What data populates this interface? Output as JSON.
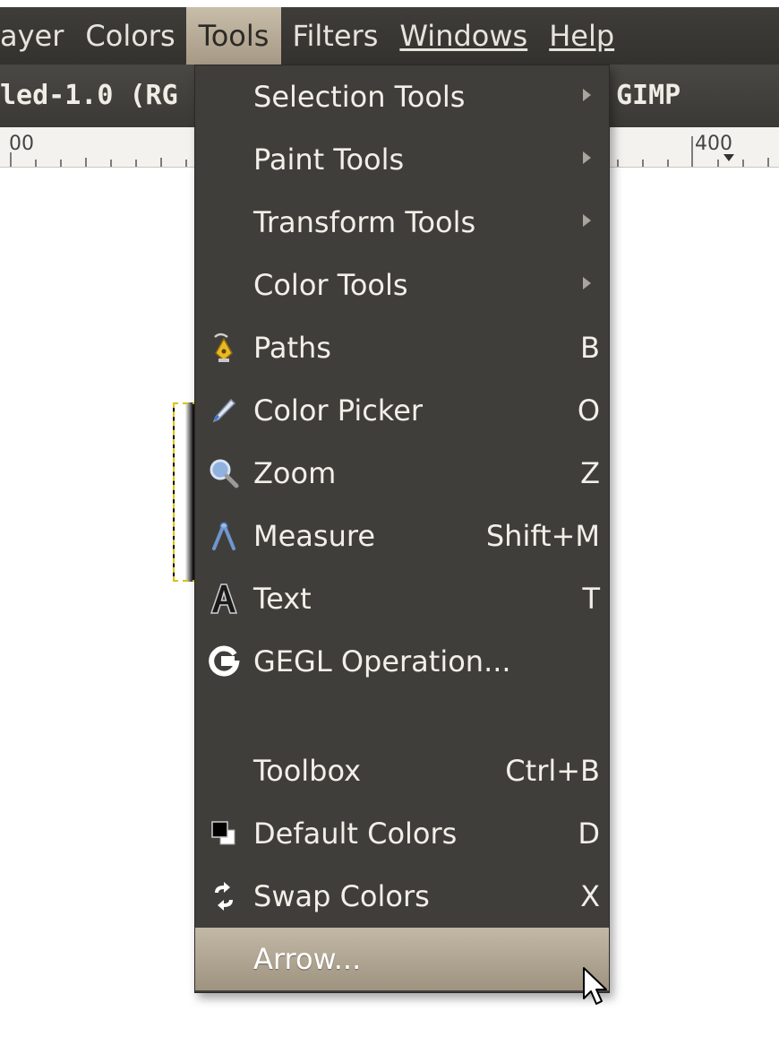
{
  "menubar": {
    "items": [
      {
        "label": "ayer"
      },
      {
        "label": "Colors"
      },
      {
        "label": "Tools"
      },
      {
        "label": "Filters"
      },
      {
        "label": "Windows"
      },
      {
        "label": "Help"
      }
    ]
  },
  "window": {
    "title_left": "led-1.0 (RG",
    "title_right": "GIMP"
  },
  "ruler": {
    "labels": [
      "00",
      "400"
    ]
  },
  "tools_menu": {
    "items": [
      {
        "label": "Selection Tools",
        "submenu": true
      },
      {
        "label": "Paint Tools",
        "submenu": true
      },
      {
        "label": "Transform Tools",
        "submenu": true
      },
      {
        "label": "Color Tools",
        "submenu": true
      },
      {
        "label": "Paths",
        "shortcut": "B",
        "icon": "paths-icon"
      },
      {
        "label": "Color Picker",
        "shortcut": "O",
        "icon": "color-picker-icon"
      },
      {
        "label": "Zoom",
        "shortcut": "Z",
        "icon": "zoom-icon"
      },
      {
        "label": "Measure",
        "shortcut": "Shift+M",
        "icon": "measure-icon"
      },
      {
        "label": "Text",
        "shortcut": "T",
        "icon": "text-icon"
      },
      {
        "label": "GEGL Operation...",
        "icon": "gegl-icon"
      },
      {
        "label": "Toolbox",
        "shortcut": "Ctrl+B"
      },
      {
        "label": "Default Colors",
        "shortcut": "D",
        "icon": "default-colors-icon"
      },
      {
        "label": "Swap Colors",
        "shortcut": "X",
        "icon": "swap-colors-icon"
      },
      {
        "label": "Arrow...",
        "highlighted": true
      }
    ]
  },
  "colors": {
    "menu_bg": "#403e3b",
    "highlight": "#b0a591",
    "menubar_bg": "#3a3834",
    "selection_marquee": "#d9c400"
  }
}
